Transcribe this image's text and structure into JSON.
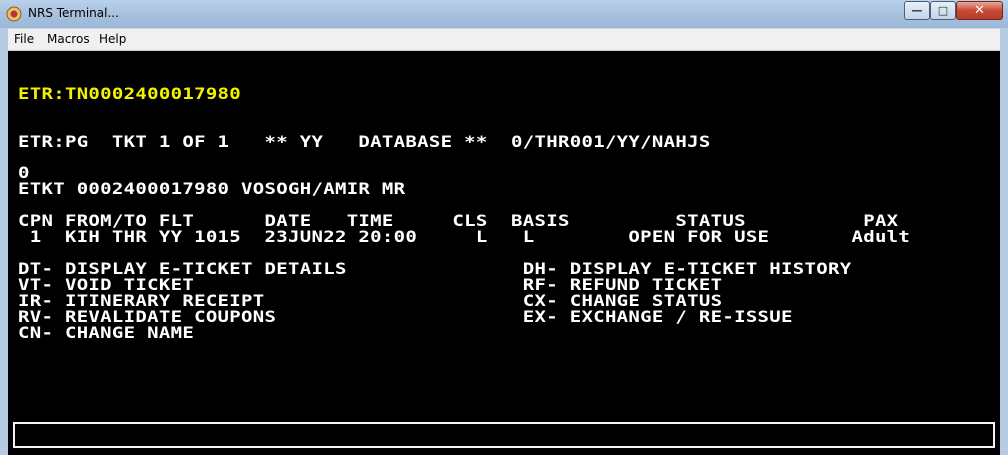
{
  "window": {
    "title": "NRS Terminal..."
  },
  "controls": {
    "minimize": "—",
    "maximize": "□",
    "close": "✕"
  },
  "menu": [
    "File",
    "Macros",
    "Help"
  ],
  "terminal": {
    "lines": [
      "ETR:TN0002400017980",
      "ETR:PG  TKT 1 OF 1   ** YY   DATABASE **  0/THR001/YY/NAHJS",
      "0",
      "ETKT 0002400017980 VOSOGH/AMIR MR",
      "CPN FROM/TO FLT      DATE   TIME     CLS  BASIS         STATUS          PAX",
      " 1  KIH THR YY 1015  23JUN22 20:00     L   L        OPEN FOR USE       Adult",
      "DT- DISPLAY E-TICKET DETAILS               DH- DISPLAY E-TICKET HISTORY",
      "VT- VOID TICKET                            RF- REFUND TICKET",
      "IR- ITINERARY RECEIPT                      CX- CHANGE STATUS",
      "RV- REVALIDATE COUPONS                     EX- EXCHANGE / RE-ISSUE",
      "CN- CHANGE NAME"
    ]
  },
  "command_input": {
    "value": ""
  },
  "colors": {
    "highlight": "#f2f200",
    "text": "#ffffff",
    "background": "#000000"
  }
}
